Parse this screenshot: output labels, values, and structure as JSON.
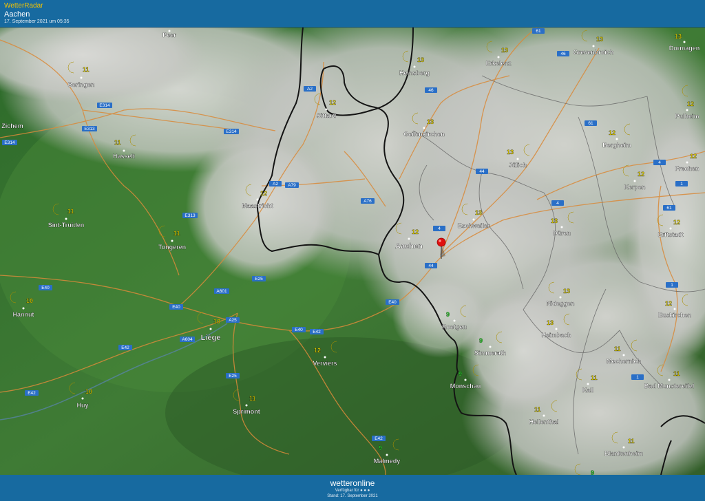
{
  "header": {
    "app_title": "WetterRadar",
    "location": "Aachen",
    "timestamp": "17. September 2021 um 05:35"
  },
  "footer": {
    "brand": "wetteronline",
    "available_for": "Verfügbar für",
    "stand": "Stand: 17. September 2021"
  },
  "colors": {
    "temp_label": "#f5e100",
    "temp_low": "#2fe02f",
    "header": "#176aa0",
    "road_badge": "#2a6fc7",
    "pin": "#e01010"
  },
  "icons": [
    "moon-icon",
    "location-pin-icon",
    "road-badge"
  ],
  "cities": [
    {
      "name": "Peer",
      "temp": ""
    },
    {
      "name": "Beringen",
      "temp": "11"
    },
    {
      "name": "Zichem",
      "temp": ""
    },
    {
      "name": "Hasselt",
      "temp": "11"
    },
    {
      "name": "Sint-Truiden",
      "temp": "11"
    },
    {
      "name": "Tongeren",
      "temp": "11"
    },
    {
      "name": "Hannut",
      "temp": "10"
    },
    {
      "name": "Liège",
      "temp": "10"
    },
    {
      "name": "Huy",
      "temp": "10"
    },
    {
      "name": "Sprimont",
      "temp": "11"
    },
    {
      "name": "Verviers",
      "temp": "12"
    },
    {
      "name": "Malmedy",
      "temp": "9"
    },
    {
      "name": "Maastricht",
      "temp": "12"
    },
    {
      "name": "Sittard",
      "temp": "12"
    },
    {
      "name": "Heinsberg",
      "temp": "13"
    },
    {
      "name": "Geilenkirchen",
      "temp": "13"
    },
    {
      "name": "Erkelenz",
      "temp": "13"
    },
    {
      "name": "Grevenbroich",
      "temp": "13"
    },
    {
      "name": "Dormagen",
      "temp": "13"
    },
    {
      "name": "Pulheim",
      "temp": "12"
    },
    {
      "name": "Bergheim",
      "temp": "12"
    },
    {
      "name": "Frechen",
      "temp": "12"
    },
    {
      "name": "Kerpen",
      "temp": "12"
    },
    {
      "name": "Jülich",
      "temp": "13"
    },
    {
      "name": "Eschweiler",
      "temp": "13"
    },
    {
      "name": "Aachen",
      "temp": "12"
    },
    {
      "name": "Düren",
      "temp": "13"
    },
    {
      "name": "Erftstadt",
      "temp": "12"
    },
    {
      "name": "Nideggen",
      "temp": "13"
    },
    {
      "name": "Heimbach",
      "temp": "13"
    },
    {
      "name": "Euskirchen",
      "temp": "12"
    },
    {
      "name": "Roetgen",
      "temp": "9"
    },
    {
      "name": "Simmerath",
      "temp": "9"
    },
    {
      "name": "Monschau",
      "temp": "9"
    },
    {
      "name": "Mechernich",
      "temp": "11"
    },
    {
      "name": "Bad Munstereifel",
      "temp": "11"
    },
    {
      "name": "Kall",
      "temp": "11"
    },
    {
      "name": "Hellenthal",
      "temp": "11"
    },
    {
      "name": "Blankenheim",
      "temp": "11"
    },
    {
      "name": "",
      "temp": "9"
    }
  ],
  "roads": [
    "61",
    "46",
    "A2",
    "46",
    "E314",
    "E313",
    "E314",
    "E314",
    "A2",
    "A79",
    "A76",
    "61",
    "44",
    "4",
    "4",
    "1",
    "4",
    "61",
    "E313",
    "A601",
    "E25",
    "E40",
    "E40",
    "A25",
    "E40",
    "A604",
    "E42",
    "E42",
    "E42",
    "E25",
    "E40",
    "1",
    "1",
    "44",
    "E42"
  ]
}
